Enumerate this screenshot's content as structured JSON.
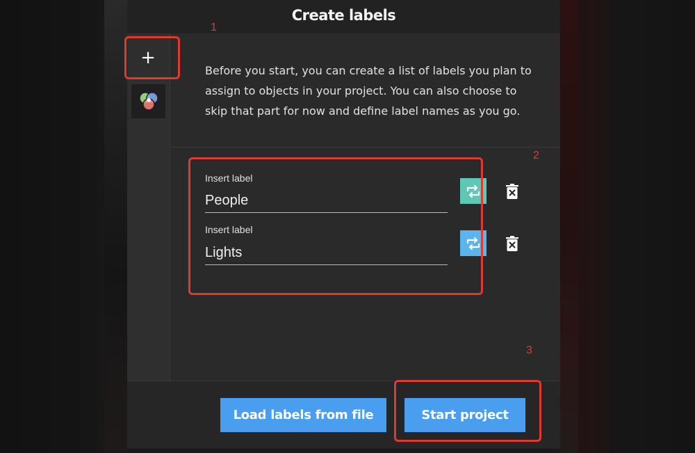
{
  "dialog": {
    "title": "Create labels",
    "description": "Before you start, you can create a list of labels you plan to assign to objects in your project. You can also choose to skip that part for now and define label names as you go."
  },
  "toolbar": {
    "add_icon": "plus-icon",
    "add_glyph": "+",
    "color_icon": "color-circles-icon"
  },
  "labels": [
    {
      "caption": "Insert label",
      "value": "People",
      "color": "#5ec7b6",
      "color_icon": "swap-color-icon",
      "delete_icon": "trash-icon"
    },
    {
      "caption": "Insert label",
      "value": "Lights",
      "color": "#5ab4ee",
      "color_icon": "swap-color-icon",
      "delete_icon": "trash-icon"
    }
  ],
  "footer": {
    "load_label": "Load labels from file",
    "start_label": "Start project"
  },
  "annotations": [
    "1",
    "2",
    "3"
  ],
  "colors": {
    "accent": "#4a9ef0",
    "annotation": "#e03a30"
  }
}
